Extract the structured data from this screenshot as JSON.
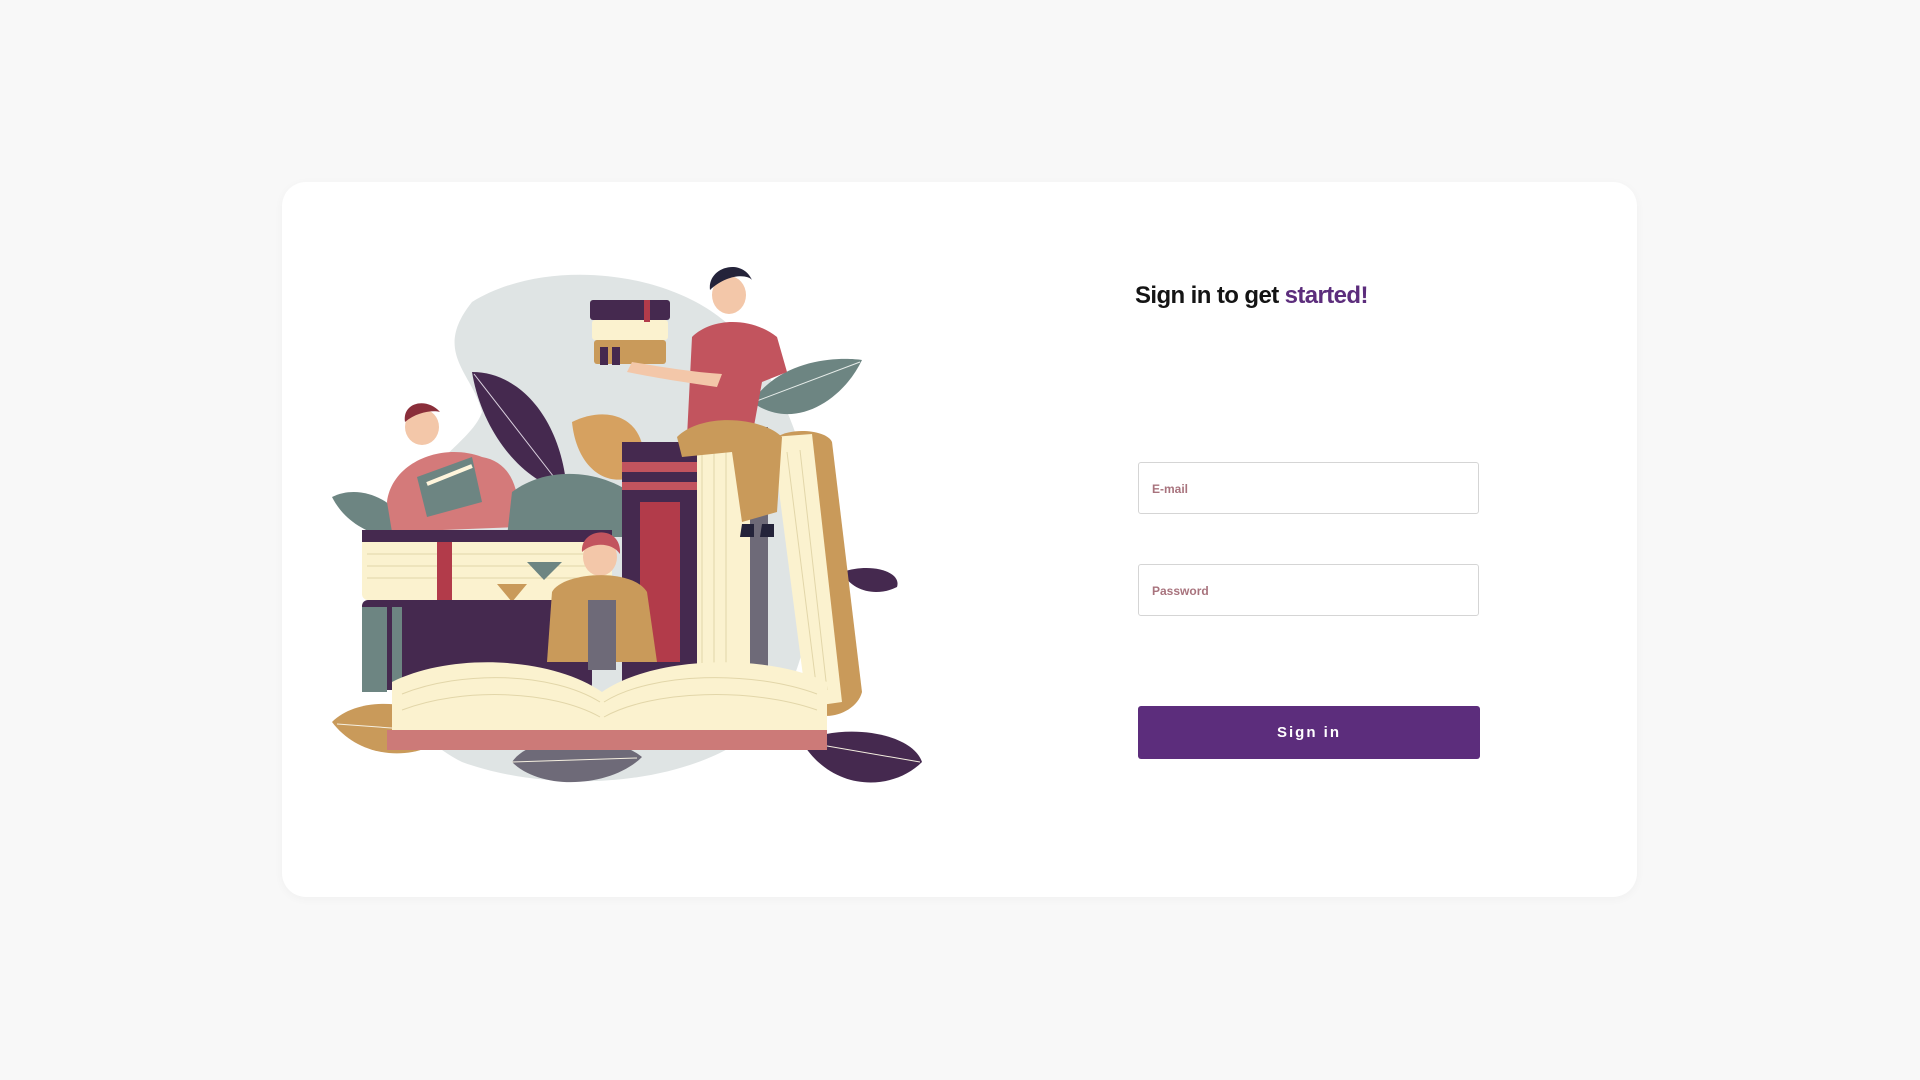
{
  "signin": {
    "title_prefix": "Sign in to get ",
    "title_accent": "started!",
    "email_placeholder": "E-mail",
    "password_placeholder": "Password",
    "submit_label": "Sign in"
  },
  "colors": {
    "accent": "#5c2d7c",
    "placeholder": "#a8737d",
    "background": "#f8f8f8",
    "card": "#ffffff"
  },
  "illustration": {
    "subject": "people-reading-books-icon"
  }
}
